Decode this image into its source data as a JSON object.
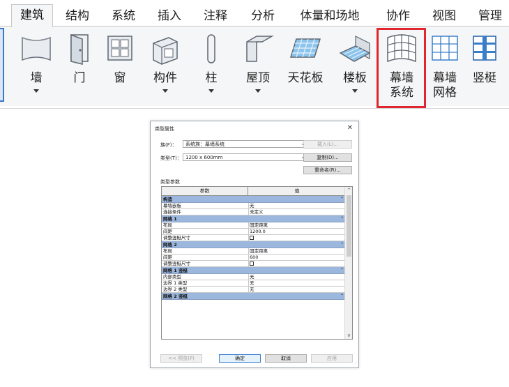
{
  "ribbon": {
    "tabs": [
      {
        "label": "建筑",
        "active": true
      },
      {
        "label": "结构"
      },
      {
        "label": "系统"
      },
      {
        "label": "插入"
      },
      {
        "label": "注释"
      },
      {
        "label": "分析"
      },
      {
        "label": "体量和场地"
      },
      {
        "label": "协作"
      },
      {
        "label": "视图"
      },
      {
        "label": "管理"
      }
    ],
    "tools": [
      {
        "label": "墙",
        "has_dropdown": true,
        "icon": "wall-icon"
      },
      {
        "label": "门",
        "icon": "door-icon"
      },
      {
        "label": "窗",
        "icon": "window-icon"
      },
      {
        "label": "构件",
        "has_dropdown": true,
        "icon": "component-icon"
      },
      {
        "label": "柱",
        "has_dropdown": true,
        "icon": "column-icon"
      },
      {
        "label": "屋顶",
        "has_dropdown": true,
        "icon": "roof-icon"
      },
      {
        "label": "天花板",
        "icon": "ceiling-icon"
      },
      {
        "label": "楼板",
        "has_dropdown": true,
        "icon": "floor-icon"
      },
      {
        "label": "幕墙",
        "label2": "系统",
        "icon": "curtain-system-icon",
        "highlighted": true
      },
      {
        "label": "幕墙",
        "label2": "网格",
        "icon": "curtain-grid-icon"
      },
      {
        "label": "竖梃",
        "icon": "mullion-icon"
      }
    ],
    "highlight_color": "#e0262e",
    "accent_color": "#3a78c9"
  },
  "dialog": {
    "title": "类型属性",
    "close_glyph": "✕",
    "family_label": "族(F)：",
    "family_value": "系统族：幕墙系统",
    "type_label": "类型(T)：",
    "type_value": "1200 x 600mm",
    "load_button": "载入(L)...",
    "duplicate_button": "复制(D)...",
    "rename_button": "重命名(R)...",
    "section_label": "类型参数",
    "col_param": "参数",
    "col_value": "值",
    "rows": [
      {
        "group": "构造"
      },
      {
        "param": "幕墙嵌板",
        "value": "无"
      },
      {
        "param": "连接条件",
        "value": "未定义"
      },
      {
        "group": "网格 1"
      },
      {
        "param": "布局",
        "value": "固定距离"
      },
      {
        "param": "间距",
        "value": "1200.0"
      },
      {
        "param": "调整竖梃尺寸",
        "checkbox": true
      },
      {
        "group": "网格 2"
      },
      {
        "param": "布局",
        "value": "固定距离"
      },
      {
        "param": "间距",
        "value": "600"
      },
      {
        "param": "调整竖梃尺寸",
        "checkbox": true
      },
      {
        "group": "网格 1 竖梃"
      },
      {
        "param": "内部类型",
        "value": "无"
      },
      {
        "param": "边界 1 类型",
        "value": "无"
      },
      {
        "param": "边界 2 类型",
        "value": "无"
      },
      {
        "group": "网格 2 竖梃"
      }
    ],
    "preview_button": "<< 预览(P)",
    "ok_button": "确定",
    "cancel_button": "取消",
    "apply_button": "应用",
    "group_row_color": "#9bb7de"
  }
}
